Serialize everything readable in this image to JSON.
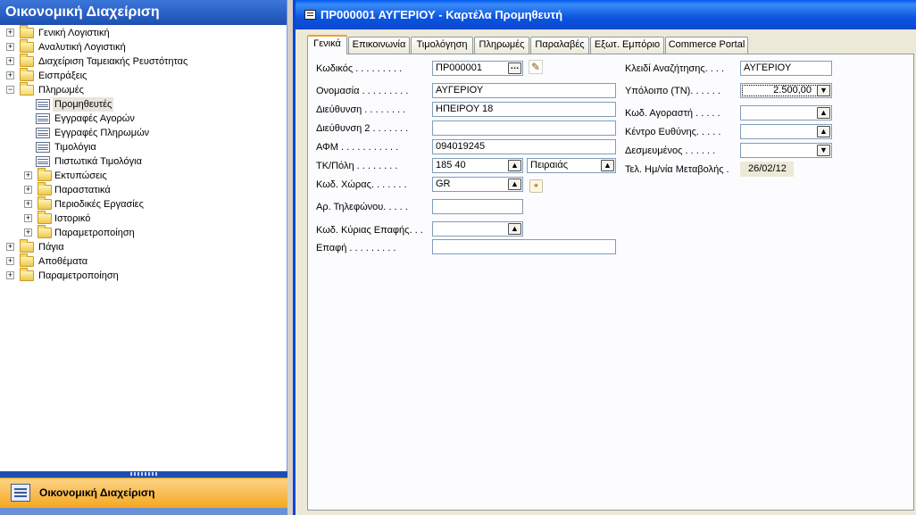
{
  "nav": {
    "title": "Οικονομική Διαχείριση",
    "tree": [
      {
        "label": "Γενική Λογιστική",
        "expander": "+"
      },
      {
        "label": "Αναλυτική Λογιστική",
        "expander": "+"
      },
      {
        "label": "Διαχείριση Ταμειακής Ρευστότητας",
        "expander": "+"
      },
      {
        "label": "Εισπράξεις",
        "expander": "+"
      },
      {
        "label": "Πληρωμές",
        "expander": "−"
      },
      {
        "label": "Προμηθευτές"
      },
      {
        "label": "Εγγραφές Αγορών"
      },
      {
        "label": "Εγγραφές Πληρωμών"
      },
      {
        "label": "Τιμολόγια"
      },
      {
        "label": "Πιστωτικά Τιμολόγια"
      },
      {
        "label": "Εκτυπώσεις",
        "expander": "+"
      },
      {
        "label": "Παραστατικά",
        "expander": "+"
      },
      {
        "label": "Περιοδικές Εργασίες",
        "expander": "+"
      },
      {
        "label": "Ιστορικό",
        "expander": "+"
      },
      {
        "label": "Παραμετροποίηση",
        "expander": "+"
      },
      {
        "label": "Πάγια",
        "expander": "+"
      },
      {
        "label": "Αποθέματα",
        "expander": "+"
      },
      {
        "label": "Παραμετροποίηση",
        "expander": "+"
      }
    ],
    "selected_item": "Προμηθευτές",
    "bottom_button": "Οικονομική Διαχείριση"
  },
  "window": {
    "title": "ΠΡ000001 ΑΥΓΕΡΙΟΥ - Καρτέλα Προμηθευτή",
    "tabs": [
      "Γενικά",
      "Επικοινωνία",
      "Τιμολόγηση",
      "Πληρωμές",
      "Παραλαβές",
      "Εξωτ. Εμπόριο",
      "Commerce Portal"
    ],
    "active_tab": "Γενικά"
  },
  "left_fields": [
    {
      "label": "Κωδικός . . . . . . . . .",
      "value": "ΠΡ000001"
    },
    {
      "label": "Ονομασία . . . . . . . . .",
      "value": "ΑΥΓΕΡΙΟΥ"
    },
    {
      "label": "Διεύθυνση . . . . . . . .",
      "value": "ΗΠΕΙΡΟΥ 18"
    },
    {
      "label": "Διεύθυνση 2 . . . . . . .",
      "value": ""
    },
    {
      "label": "ΑΦΜ . . . . . . . . . . .",
      "value": "094019245"
    },
    {
      "label": "ΤΚ/Πόλη . . . . . . . .",
      "value": "185 40",
      "city": "Πειραιάς"
    },
    {
      "label": "Κωδ. Χώρας. . . . . . .",
      "value": "GR"
    },
    {
      "label": "Αρ. Τηλεφώνου. . . . .",
      "value": ""
    },
    {
      "label": "Κωδ. Κύριας Επαφής. . .",
      "value": ""
    },
    {
      "label": "Επαφή . . . . . . . . .",
      "value": ""
    }
  ],
  "right_fields": [
    {
      "label": "Κλειδί Αναζήτησης. . . .",
      "value": "ΑΥΓΕΡΙΟΥ"
    },
    {
      "label": "Υπόλοιπο (ΤΝ). . . . . .",
      "value": "2.500,00"
    },
    {
      "label": "Κωδ. Αγοραστή . . . . .",
      "value": ""
    },
    {
      "label": "Κέντρο Ευθύνης. . . . .",
      "value": ""
    },
    {
      "label": "Δεσμευμένος . . . . . .",
      "value": ""
    },
    {
      "label": "Τελ. Ημ/νία Μεταβολής .",
      "value": "26/02/12"
    }
  ],
  "icons": {
    "expand": "plus-box-icon",
    "collapse": "minus-box-icon",
    "folder": "folder-icon",
    "page": "page-icon",
    "lookup": "up-arrow-icon",
    "drilldown": "down-arrow-icon",
    "assist": "ellipsis-icon",
    "edit": "pencil-icon",
    "map": "map-icon"
  },
  "colors": {
    "title_bar": "#0c54e0",
    "nav_title": "#2a60c4",
    "nav_button": "#f7b43a",
    "active_tab_accent": "#f0a030"
  }
}
